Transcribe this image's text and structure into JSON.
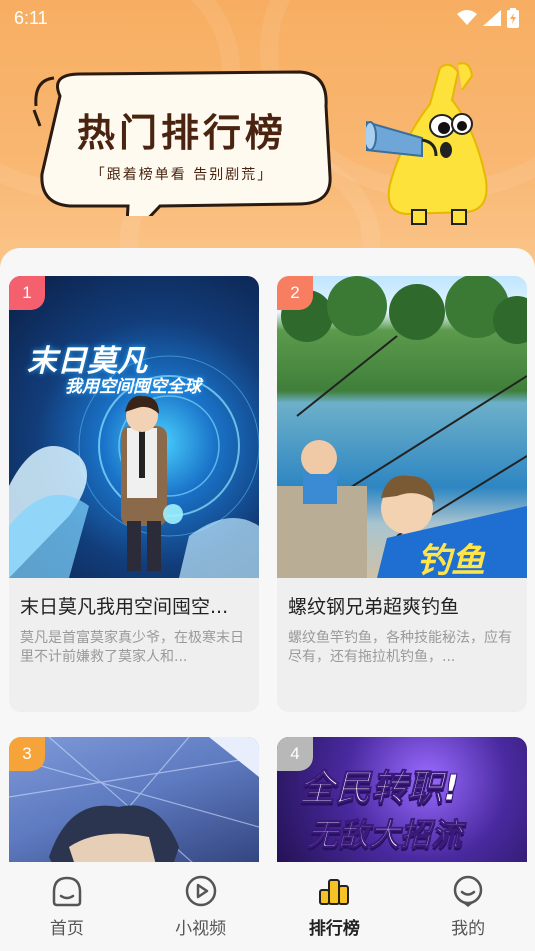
{
  "status_bar": {
    "time": "6:11"
  },
  "banner": {
    "title": "热门排行榜",
    "subtitle": "「跟着榜单看 告别剧荒」"
  },
  "cards": [
    {
      "rank": "1",
      "badge_color": "#f4606d",
      "cover_text_line1": "末日莫凡",
      "cover_text_line2": "我用空间囤空全球",
      "title": "末日莫凡我用空间囤空...",
      "desc": "莫凡是首富莫家真少爷，在极寒末日里不计前嫌救了莫家人和..."
    },
    {
      "rank": "2",
      "badge_color": "#f87e62",
      "cover_text_line1": "",
      "cover_text_line2": "",
      "title": "螺纹钢兄弟超爽钓鱼",
      "desc": "螺纹鱼竿钓鱼，各种技能秘法，应有尽有，还有拖拉机钓鱼，..."
    },
    {
      "rank": "3",
      "badge_color": "#f6a43a"
    },
    {
      "rank": "4",
      "badge_color": "#b8b8b8",
      "cover_text_line1": "全民转职!",
      "cover_text_line2": "无敌大招流"
    }
  ],
  "nav": [
    {
      "label": "首页",
      "icon": "home-icon",
      "active": false
    },
    {
      "label": "小视频",
      "icon": "play-icon",
      "active": false
    },
    {
      "label": "排行榜",
      "icon": "ranking-icon",
      "active": true
    },
    {
      "label": "我的",
      "icon": "profile-icon",
      "active": false
    }
  ]
}
